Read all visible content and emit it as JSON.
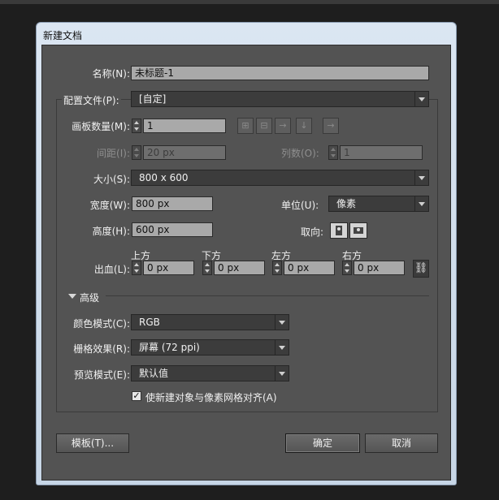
{
  "dialog": {
    "title": "新建文档"
  },
  "name": {
    "label": "名称(N):",
    "value": "未标题-1"
  },
  "profile": {
    "label": "配置文件(P):",
    "value": "[自定]"
  },
  "artboards": {
    "count_label": "画板数量(M):",
    "count_value": "1",
    "spacing_label": "间距(I):",
    "spacing_value": "20 px",
    "columns_label": "列数(O):",
    "columns_value": "1"
  },
  "size": {
    "label": "大小(S):",
    "value": "800 x 600"
  },
  "width": {
    "label": "宽度(W):",
    "value": "800 px"
  },
  "units": {
    "label": "单位(U):",
    "value": "像素"
  },
  "height": {
    "label": "高度(H):",
    "value": "600 px"
  },
  "orientation": {
    "label": "取向:"
  },
  "bleed": {
    "label": "出血(L):",
    "top_label": "上方",
    "top_value": "0 px",
    "bottom_label": "下方",
    "bottom_value": "0 px",
    "left_label": "左方",
    "left_value": "0 px",
    "right_label": "右方",
    "right_value": "0 px"
  },
  "advanced": {
    "label": "高级"
  },
  "color_mode": {
    "label": "颜色模式(C):",
    "value": "RGB"
  },
  "raster_effects": {
    "label": "栅格效果(R):",
    "value": "屏幕 (72 ppi)"
  },
  "preview_mode": {
    "label": "预览模式(E):",
    "value": "默认值"
  },
  "align_pixel_grid": {
    "label": "使新建对象与像素网格对齐(A)",
    "checked": true
  },
  "buttons": {
    "templates": "模板(T)...",
    "ok": "确定",
    "cancel": "取消"
  }
}
